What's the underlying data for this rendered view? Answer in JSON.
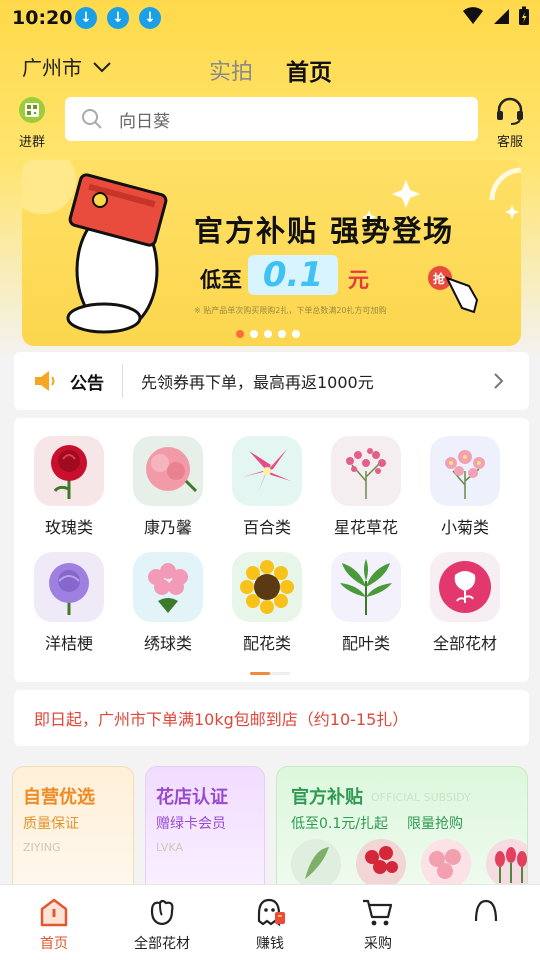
{
  "status_bar": {
    "time": "10:20"
  },
  "header": {
    "city": "广州市",
    "tabs": [
      {
        "label": "实拍"
      },
      {
        "label": "首页"
      }
    ],
    "join_group_label": "进群",
    "search_placeholder": "向日葵",
    "service_label": "客服"
  },
  "banner": {
    "title": "官方补贴 强势登场",
    "low_prefix": "低至",
    "price": "0.1",
    "unit": "元",
    "note": "※ 贴产品单次购买限购2扎，下单总数满20扎方可加购",
    "active_dot": 0,
    "dot_count": 5
  },
  "notice": {
    "label": "公告",
    "text": "先领券再下单，最高再返1000元"
  },
  "categories": [
    {
      "label": "玫瑰类"
    },
    {
      "label": "康乃馨"
    },
    {
      "label": "百合类"
    },
    {
      "label": "星花草花"
    },
    {
      "label": "小菊类"
    },
    {
      "label": "洋桔梗"
    },
    {
      "label": "绣球类"
    },
    {
      "label": "配花类"
    },
    {
      "label": "配叶类"
    },
    {
      "label": "全部花材"
    }
  ],
  "shipping": {
    "text": "即日起，广州市下单满10kg包邮到店（约10-15扎）"
  },
  "cards": {
    "ziying": {
      "title": "自营优选",
      "sub": "质量保证",
      "en": "ZIYING"
    },
    "huadian": {
      "title": "花店认证",
      "sub": "赠绿卡会员",
      "en": "LVKA"
    },
    "guanfang": {
      "title": "官方补贴",
      "en": "OFFICIAL SUBSIDY",
      "sub1": "低至0.1元/扎起",
      "sub2": "限量抢购"
    }
  },
  "bottom_nav": [
    {
      "label": "首页",
      "active": true
    },
    {
      "label": "全部花材"
    },
    {
      "label": "赚钱"
    },
    {
      "label": "采购"
    },
    {
      "label": ""
    }
  ],
  "colors": {
    "accent": "#e0592e",
    "brand_yellow": "#ffd94a",
    "notice_red": "#e0473b",
    "green": "#2f9a55"
  }
}
